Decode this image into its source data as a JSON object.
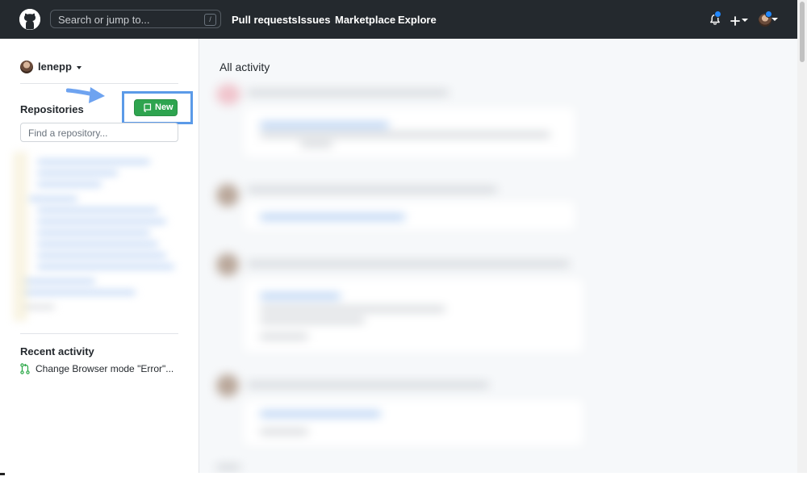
{
  "header": {
    "search": {
      "placeholder": "Search or jump to...",
      "shortcut": "/"
    },
    "nav": [
      "Pull requests",
      "Issues",
      "Marketplace",
      "Explore"
    ],
    "icons": [
      "github-logo-icon",
      "bell-icon",
      "plus-icon",
      "avatar"
    ],
    "notification_color": "#2188ff"
  },
  "sidebar": {
    "username": "lenepp",
    "repositories": {
      "title": "Repositories",
      "new_label": "New",
      "find_placeholder": "Find a repository..."
    },
    "recent": {
      "title": "Recent activity",
      "items": [
        {
          "icon": "pull-request-icon",
          "label": "Change Browser mode \"Error\"..."
        }
      ]
    }
  },
  "main": {
    "title": "All activity"
  },
  "colors": {
    "header_bg": "#24292e",
    "new_button": "#2ea44f",
    "highlight": "#5b9ae8"
  }
}
